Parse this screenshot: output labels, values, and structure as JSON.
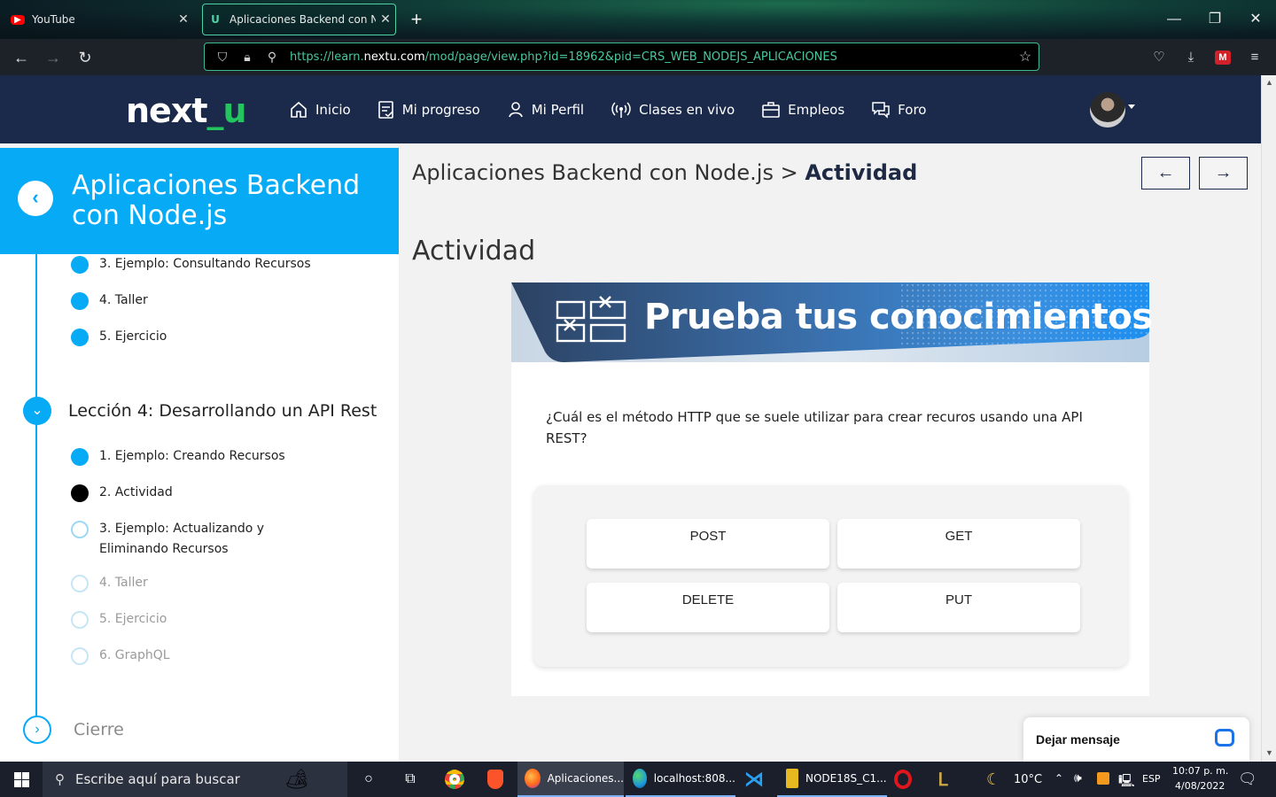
{
  "browser": {
    "tabs": [
      {
        "title": "YouTube",
        "close": "✕"
      },
      {
        "title": "Aplicaciones Backend con Node",
        "close": "✕"
      }
    ],
    "new_tab": "+",
    "url_prefix": "https://learn.",
    "url_domain": "nextu.com",
    "url_path": "/mod/page/view.php?id=18962&pid=CRS_WEB_NODEJS_APLICACIONES"
  },
  "site": {
    "logo_main": "next",
    "logo_accent": "_u",
    "menu": [
      {
        "label": "Inicio",
        "icon": "home-icon"
      },
      {
        "label": "Mi progreso",
        "icon": "progress-icon"
      },
      {
        "label": "Mi Perfil",
        "icon": "user-icon"
      },
      {
        "label": "Clases en vivo",
        "icon": "broadcast-icon"
      },
      {
        "label": "Empleos",
        "icon": "briefcase-icon"
      },
      {
        "label": "Foro",
        "icon": "chat-icon"
      }
    ]
  },
  "sidebar": {
    "course_title": "Aplicaciones Backend con Node.js",
    "prev_items": [
      {
        "label": "3. Ejemplo: Consultando Recursos",
        "status": "done"
      },
      {
        "label": "4. Taller",
        "status": "done"
      },
      {
        "label": "5. Ejercicio",
        "status": "done"
      }
    ],
    "lesson_title": "Lección 4: Desarrollando un API Rest",
    "lesson_items": [
      {
        "label": "1. Ejemplo: Creando Recursos",
        "status": "done"
      },
      {
        "label": "2. Actividad",
        "status": "current"
      },
      {
        "label": "3. Ejemplo: Actualizando y Eliminando Recursos",
        "status": "todo"
      },
      {
        "label": "4. Taller",
        "status": "todo"
      },
      {
        "label": "5. Ejercicio",
        "status": "todo"
      },
      {
        "label": "6. GraphQL",
        "status": "todo"
      }
    ],
    "closing_title": "Cierre"
  },
  "main": {
    "breadcrumb_course": "Aplicaciones Backend con Node.js",
    "breadcrumb_sep": ">",
    "breadcrumb_current": "Actividad",
    "prev_arrow": "←",
    "next_arrow": "→",
    "page_title": "Actividad",
    "banner_text": "Prueba tus conocimientos",
    "question": "¿Cuál es el método HTTP que se suele utilizar para crear recuros usando una API REST?",
    "answers": [
      "POST",
      "GET",
      "DELETE",
      "PUT"
    ]
  },
  "chat_widget": {
    "label": "Dejar mensaje"
  },
  "taskbar": {
    "search_placeholder": "Escribe aquí para buscar",
    "apps": [
      {
        "label": "Aplicaciones...",
        "color": "#ff6a1a"
      },
      {
        "label": "localhost:808...",
        "color": "#1f9ad6"
      },
      {
        "label": "NODE18S_C1...",
        "color": "#e8b820"
      }
    ],
    "weather": "10°C",
    "language": "ESP",
    "time": "10:07 p. m.",
    "date": "4/08/2022"
  },
  "colors": {
    "accent": "#06aaf5",
    "header_bg": "#1b2a4a",
    "logo_green": "#22c55e"
  }
}
